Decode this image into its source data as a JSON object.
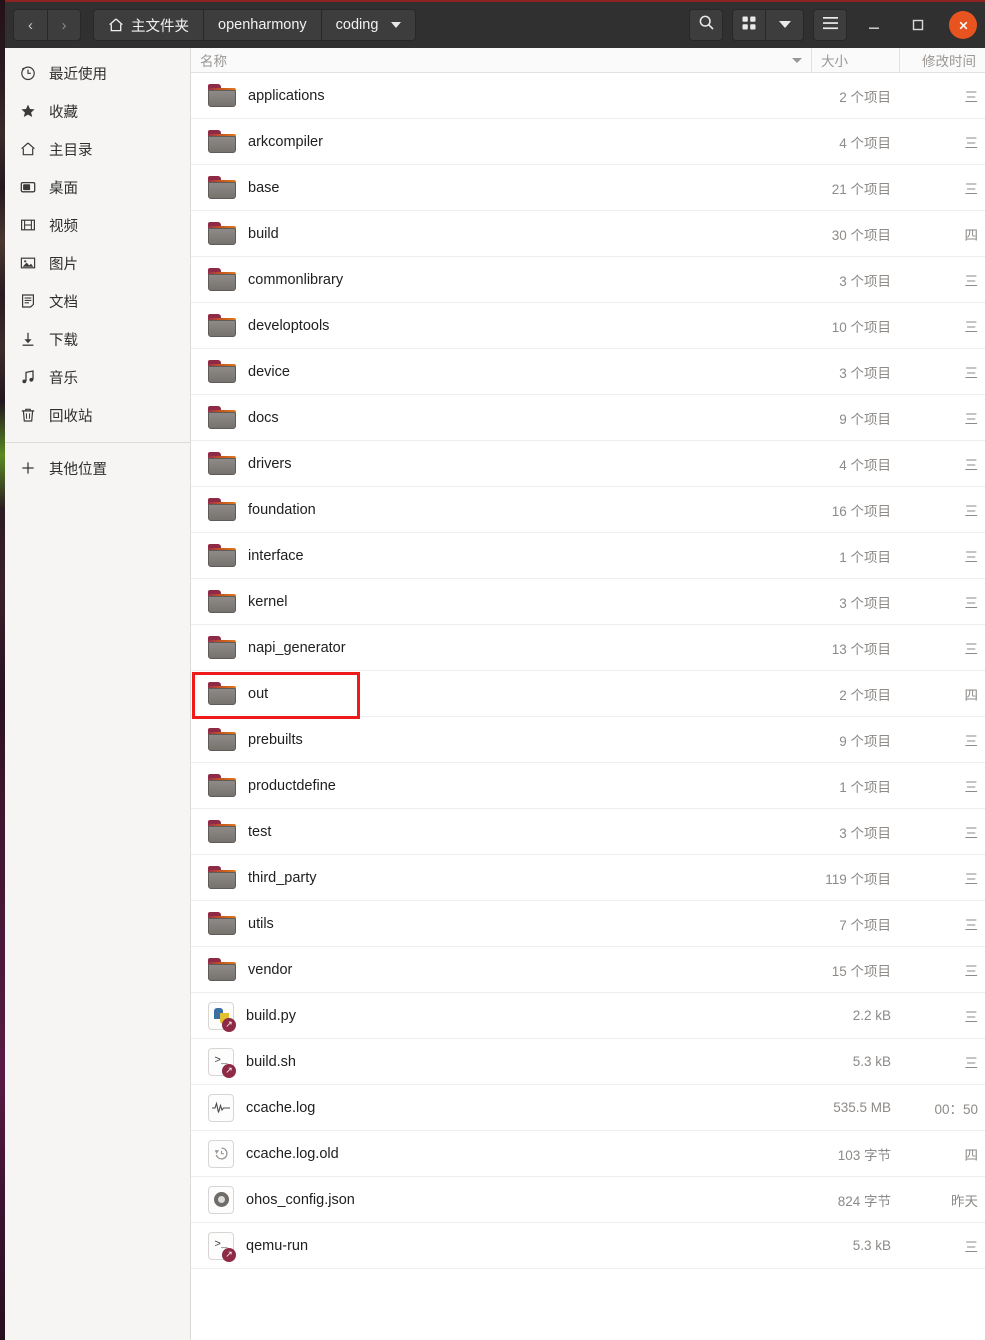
{
  "window": {
    "accent_close": "#e8541f",
    "titlebar_bg": "#303030",
    "highlight_color": "#ef1b1b"
  },
  "header": {
    "nav": [
      {
        "name": "back-button",
        "glyph": "‹"
      },
      {
        "name": "forward-button",
        "glyph": "›"
      }
    ],
    "breadcrumbs": [
      {
        "label": "主文件夹",
        "icon": "home-icon",
        "has_menu": false
      },
      {
        "label": "openharmony",
        "icon": "",
        "has_menu": false
      },
      {
        "label": "coding",
        "icon": "",
        "has_menu": true
      }
    ],
    "tools": {
      "search_label": "",
      "view_grid_label": "",
      "view_dropdown_label": "",
      "menu_label": ""
    },
    "window_buttons": {
      "minimize": "–",
      "maximize": "□",
      "close": "✕"
    }
  },
  "sidebar": {
    "items": [
      {
        "label": "最近使用",
        "icon": "clock-icon"
      },
      {
        "label": "收藏",
        "icon": "star-icon"
      },
      {
        "label": "主目录",
        "icon": "home-icon"
      },
      {
        "label": "桌面",
        "icon": "desktop-icon"
      },
      {
        "label": "视频",
        "icon": "film-icon"
      },
      {
        "label": "图片",
        "icon": "image-icon"
      },
      {
        "label": "文档",
        "icon": "document-icon"
      },
      {
        "label": "下载",
        "icon": "download-icon"
      },
      {
        "label": "音乐",
        "icon": "music-icon"
      },
      {
        "label": "回收站",
        "icon": "trash-icon"
      }
    ],
    "other_locations": {
      "label": "其他位置",
      "icon": "plus-icon"
    }
  },
  "filelist": {
    "columns": [
      {
        "key": "name",
        "label": "名称",
        "sorted": true,
        "sort_dir": "desc"
      },
      {
        "key": "size",
        "label": "大小"
      },
      {
        "key": "time",
        "label": "修改时间"
      }
    ],
    "highlighted_row": "out",
    "rows": [
      {
        "name": "applications",
        "icon": "folder-icon",
        "size": "2 个项目",
        "time": "三"
      },
      {
        "name": "arkcompiler",
        "icon": "folder-icon",
        "size": "4 个项目",
        "time": "三"
      },
      {
        "name": "base",
        "icon": "folder-icon",
        "size": "21 个项目",
        "time": "三"
      },
      {
        "name": "build",
        "icon": "folder-icon",
        "size": "30 个项目",
        "time": "四"
      },
      {
        "name": "commonlibrary",
        "icon": "folder-icon",
        "size": "3 个项目",
        "time": "三"
      },
      {
        "name": "developtools",
        "icon": "folder-icon",
        "size": "10 个项目",
        "time": "三"
      },
      {
        "name": "device",
        "icon": "folder-icon",
        "size": "3 个项目",
        "time": "三"
      },
      {
        "name": "docs",
        "icon": "folder-icon",
        "size": "9 个项目",
        "time": "三"
      },
      {
        "name": "drivers",
        "icon": "folder-icon",
        "size": "4 个项目",
        "time": "三"
      },
      {
        "name": "foundation",
        "icon": "folder-icon",
        "size": "16 个项目",
        "time": "三"
      },
      {
        "name": "interface",
        "icon": "folder-icon",
        "size": "1 个项目",
        "time": "三"
      },
      {
        "name": "kernel",
        "icon": "folder-icon",
        "size": "3 个项目",
        "time": "三"
      },
      {
        "name": "napi_generator",
        "icon": "folder-icon",
        "size": "13 个项目",
        "time": "三"
      },
      {
        "name": "out",
        "icon": "folder-icon",
        "size": "2 个项目",
        "time": "四"
      },
      {
        "name": "prebuilts",
        "icon": "folder-icon",
        "size": "9 个项目",
        "time": "三"
      },
      {
        "name": "productdefine",
        "icon": "folder-icon",
        "size": "1 个项目",
        "time": "三"
      },
      {
        "name": "test",
        "icon": "folder-icon",
        "size": "3 个项目",
        "time": "三"
      },
      {
        "name": "third_party",
        "icon": "folder-icon",
        "size": "119 个项目",
        "time": "三"
      },
      {
        "name": "utils",
        "icon": "folder-icon",
        "size": "7 个项目",
        "time": "三"
      },
      {
        "name": "vendor",
        "icon": "folder-icon",
        "size": "15 个项目",
        "time": "三"
      },
      {
        "name": "build.py",
        "icon": "python-file-icon",
        "size": "2.2 kB",
        "time": "三"
      },
      {
        "name": "build.sh",
        "icon": "shell-file-icon",
        "size": "5.3 kB",
        "time": "三"
      },
      {
        "name": "ccache.log",
        "icon": "log-file-icon",
        "size": "535.5 MB",
        "time": "00：50"
      },
      {
        "name": "ccache.log.old",
        "icon": "backup-file-icon",
        "size": "103 字节",
        "time": "四"
      },
      {
        "name": "ohos_config.json",
        "icon": "json-file-icon",
        "size": "824 字节",
        "time": "昨天"
      },
      {
        "name": "qemu-run",
        "icon": "shell-file-icon",
        "size": "5.3 kB",
        "time": "三"
      }
    ]
  }
}
